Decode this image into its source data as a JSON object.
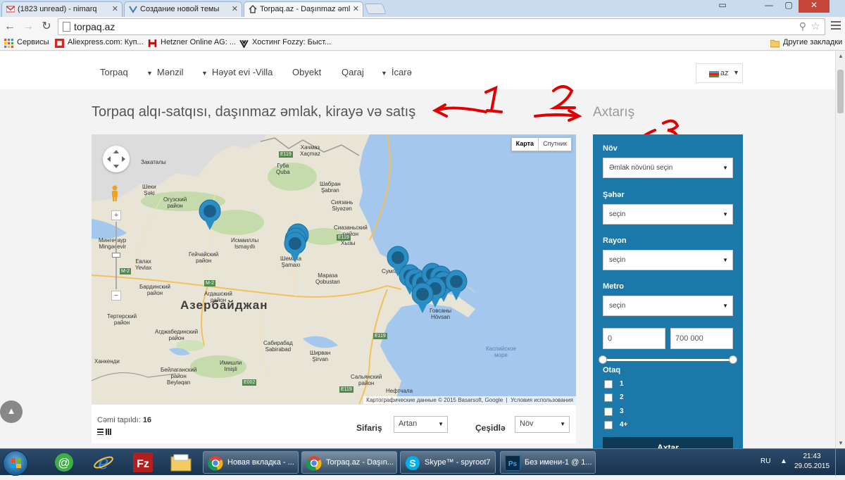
{
  "browser": {
    "tabs": [
      {
        "title": "(1823 unread) - nimarq",
        "icon": "gmail-icon"
      },
      {
        "title": "Создание новой темы",
        "icon": "forum-icon"
      },
      {
        "title": "Torpaq.az - Daşınmaz əml",
        "icon": "home-icon",
        "active": true
      }
    ],
    "url": "torpaq.az",
    "bookmarks": [
      {
        "label": "Сервисы",
        "icon": "apps-icon"
      },
      {
        "label": "Aliexpress.com: Куп...",
        "icon": "aliexpress-icon"
      },
      {
        "label": "Hetzner Online AG: ...",
        "icon": "hetzner-icon"
      },
      {
        "label": "Хостинг Fozzy: Быст...",
        "icon": "fozzy-icon"
      }
    ],
    "other_bookmarks": "Другие закладки"
  },
  "site": {
    "nav": [
      {
        "label": "Torpaq",
        "caret": false
      },
      {
        "label": "Mənzil",
        "caret": true
      },
      {
        "label": "Həyət evi -Villa",
        "caret": true
      },
      {
        "label": "Obyekt",
        "caret": false
      },
      {
        "label": "Qaraj",
        "caret": false
      },
      {
        "label": "İcarə",
        "caret": true
      }
    ],
    "lang": "az",
    "title": "Torpaq alqı-satqısı, daşınmaz əmlak, kirayə və satış",
    "search_title": "Axtarış"
  },
  "map": {
    "type_buttons": [
      "Карта",
      "Спутник"
    ],
    "attribution": "Картографические данные © 2015 Basarsoft, Google",
    "terms": "Условия использования",
    "country_label": "Азербайджан",
    "labels": [
      {
        "text": "Хачмаз\nXaçmaz"
      },
      {
        "text": "Губа\nQuba"
      },
      {
        "text": "Шабран\nŞabran"
      },
      {
        "text": "Сиязань\nSiyəzən"
      },
      {
        "text": "Закаталы"
      },
      {
        "text": "Шеки\nŞəki"
      },
      {
        "text": "Огузский\nрайон"
      },
      {
        "text": "Исмаиллы\nIsmayıllı"
      },
      {
        "text": "Шемаха\nŞamaxı"
      },
      {
        "text": "Сиазаньский\nрайон"
      },
      {
        "text": "Хызы"
      },
      {
        "text": "Мараза\nQobustan"
      },
      {
        "text": "Сумгайыт"
      },
      {
        "text": "Говсаны\nHövsan"
      },
      {
        "text": "Мингечаур\nMingəçevir"
      },
      {
        "text": "Евлах\nYevlax"
      },
      {
        "text": "Гейчайский\nрайон"
      },
      {
        "text": "Бардинский\nрайон"
      },
      {
        "text": "Агдашский\nрайон"
      },
      {
        "text": "Тертерский\nрайон"
      },
      {
        "text": "Агджабединский\nрайон"
      },
      {
        "text": "Сабирабад\nSabirabad"
      },
      {
        "text": "Ширван\nŞirvan"
      },
      {
        "text": "Имишли\nImişli"
      },
      {
        "text": "Ханкенди"
      },
      {
        "text": "Бейлаганский\nрайон\nBeyləqan"
      },
      {
        "text": "Сальянский\nрайон"
      },
      {
        "text": "Нефтчала"
      },
      {
        "text": "Каспийское\nморе"
      }
    ],
    "roads": [
      "E119",
      "E119",
      "M-2",
      "M-2",
      "E119",
      "E002",
      "E119"
    ],
    "markers": 14
  },
  "results": {
    "found_label": "Cəmi tapıldı:",
    "found_count": "16",
    "sort_label": "Sifariş",
    "sort_value": "Artan",
    "filter_label": "Çeşidlə",
    "filter_value": "Növ"
  },
  "search": {
    "type_label": "Növ",
    "type_placeholder": "Əmlak növünü seçin",
    "city_label": "Şəhər",
    "city_value": "seçin",
    "district_label": "Rayon",
    "district_value": "seçin",
    "metro_label": "Metro",
    "metro_value": "seçin",
    "price_min": "0",
    "price_max": "700 000",
    "rooms_label": "Otaq",
    "rooms": [
      "1",
      "2",
      "3",
      "4+"
    ],
    "button": "Axtar"
  },
  "taskbar": {
    "tasks": [
      {
        "label": "Новая вкладка - ...",
        "icon": "chrome-icon"
      },
      {
        "label": "Torpaq.az - Daşın...",
        "icon": "chrome-icon"
      },
      {
        "label": "Skype™ - spyroot7",
        "icon": "skype-icon"
      },
      {
        "label": "Без имени-1 @ 1...",
        "icon": "photoshop-icon"
      }
    ],
    "lang": "RU",
    "time": "21:43",
    "date": "29.05.2015"
  },
  "colors": {
    "search_panel": "#1c78a8",
    "search_button": "#0e3a55",
    "marker": "#2a8ec4",
    "annotation": "#e00000"
  }
}
